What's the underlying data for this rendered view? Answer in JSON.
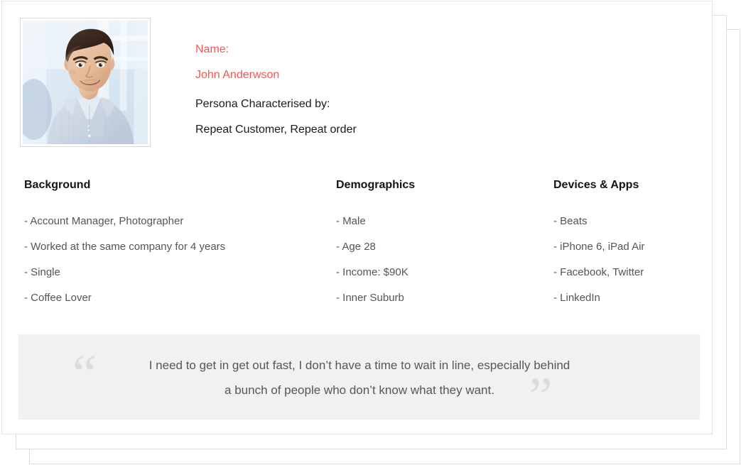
{
  "card": {
    "identity": {
      "name_label": "Name:",
      "name_value": "John Anderwson",
      "persona_label": "Persona Characterised by:",
      "persona_value": "Repeat Customer, Repeat order"
    },
    "photo": {
      "alt": "portrait-photo-of-smiling-man-in-light-blue-shirt"
    },
    "columns": [
      {
        "title": "Background",
        "items": [
          "- Account Manager, Photographer",
          "- Worked at the same company for 4 years",
          "- Single",
          "- Coffee Lover"
        ]
      },
      {
        "title": "Demographics",
        "items": [
          "- Male",
          "- Age 28",
          "- Income: $90K",
          "- Inner Suburb"
        ]
      },
      {
        "title": "Devices & Apps",
        "items": [
          "- Beats",
          "- iPhone 6, iPad Air",
          "- Facebook, Twitter",
          "- LinkedIn"
        ]
      }
    ],
    "quote": {
      "open_mark": "“",
      "close_mark": "”",
      "line1": "I need to get in get out fast, I don’t have a time to wait in line, especially behind",
      "line2": "a bunch of people who don’t know what they want."
    }
  },
  "colors": {
    "accent_red": "#f9564f",
    "heading": "#141414",
    "body_text": "#555555",
    "quote_bg": "#f1f1f1",
    "quote_mark": "#dcdcdc",
    "card_border": "#dcdcdc"
  }
}
